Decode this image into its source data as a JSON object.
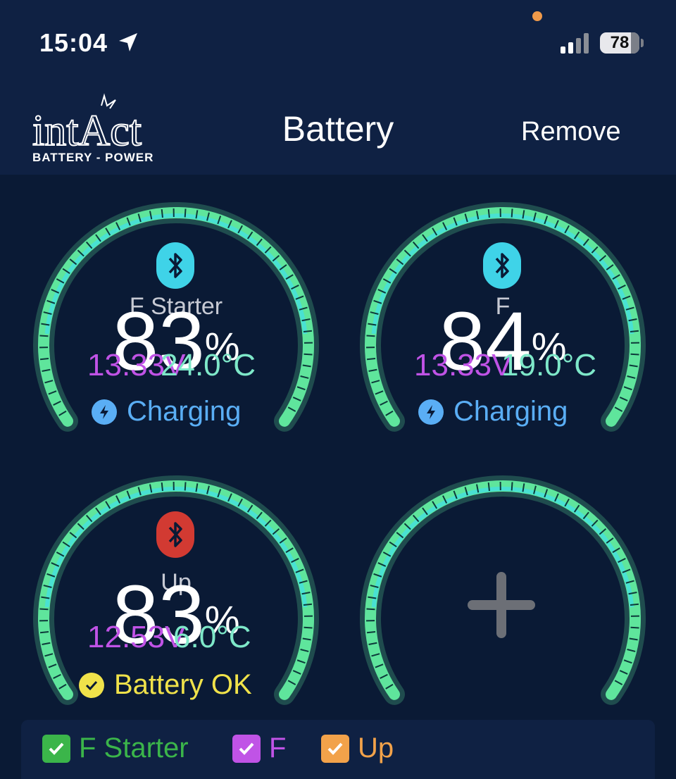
{
  "status": {
    "time": "15:04",
    "battery_level": "78"
  },
  "header": {
    "logo_text": "intAct",
    "logo_subtitle": "BATTERY - POWER",
    "title": "Battery",
    "remove_label": "Remove"
  },
  "gauges": [
    {
      "name": "F Starter",
      "percent": "83",
      "percent_unit": "%",
      "voltage": "13.33V",
      "temperature": "24.0°C",
      "status": "Charging",
      "bluetooth_color": "#3fd3e8",
      "status_color": "#5aaef5"
    },
    {
      "name": "F",
      "percent": "84",
      "percent_unit": "%",
      "voltage": "13.33V",
      "temperature": "19.0°C",
      "status": "Charging",
      "bluetooth_color": "#3fd3e8",
      "status_color": "#5aaef5"
    },
    {
      "name": "Up",
      "percent": "83",
      "percent_unit": "%",
      "voltage": "12.53V",
      "temperature": "6.0°C",
      "status": "Battery OK",
      "bluetooth_color": "#d23a32",
      "status_color": "#f0e24a"
    }
  ],
  "add_slot": {
    "icon": "plus-icon"
  },
  "legend": [
    {
      "label": "F Starter",
      "color": "#3bb54a"
    },
    {
      "label": "F",
      "color": "#c053e6"
    },
    {
      "label": "Up",
      "color": "#f2a24a"
    }
  ],
  "colors": {
    "gauge_green": "#5fe59c",
    "gauge_cyan": "#47e0d8",
    "background": "#0a1a35",
    "header": "#0f2143"
  }
}
